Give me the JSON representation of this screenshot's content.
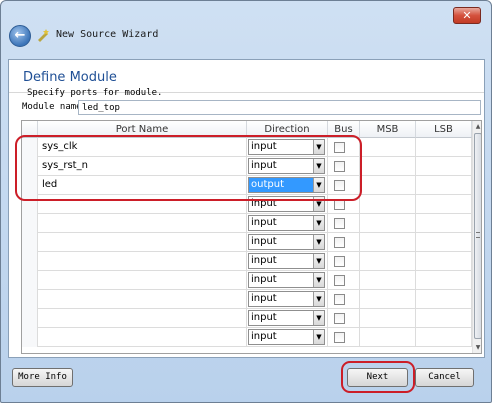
{
  "window": {
    "title": "New Source Wizard",
    "close_label": "✕"
  },
  "page": {
    "heading": "Define Module",
    "subtitle": "Specify ports for module.",
    "module_name_label": "Module name",
    "module_name_value": "led_top"
  },
  "table": {
    "columns": [
      "Port Name",
      "Direction",
      "Bus",
      "MSB",
      "LSB"
    ],
    "rows": [
      {
        "name": "sys_clk",
        "direction": "input",
        "bus": false
      },
      {
        "name": "sys_rst_n",
        "direction": "input",
        "bus": false
      },
      {
        "name": "led",
        "direction": "output",
        "bus": false,
        "selected": true
      },
      {
        "name": "",
        "direction": "input",
        "bus": false
      },
      {
        "name": "",
        "direction": "input",
        "bus": false
      },
      {
        "name": "",
        "direction": "input",
        "bus": false
      },
      {
        "name": "",
        "direction": "input",
        "bus": false
      },
      {
        "name": "",
        "direction": "input",
        "bus": false
      },
      {
        "name": "",
        "direction": "input",
        "bus": false
      },
      {
        "name": "",
        "direction": "input",
        "bus": false
      },
      {
        "name": "",
        "direction": "input",
        "bus": false
      }
    ]
  },
  "buttons": {
    "more_info": "More Info",
    "next": "Next",
    "cancel": "Cancel"
  },
  "icons": {
    "back": "back-arrow-icon",
    "wizard": "wizard-wand-icon",
    "dropdown": "chevron-down-icon"
  },
  "colors": {
    "annotation": "#cc1e28",
    "heading": "#1f4f95",
    "selection": "#3399ff"
  }
}
